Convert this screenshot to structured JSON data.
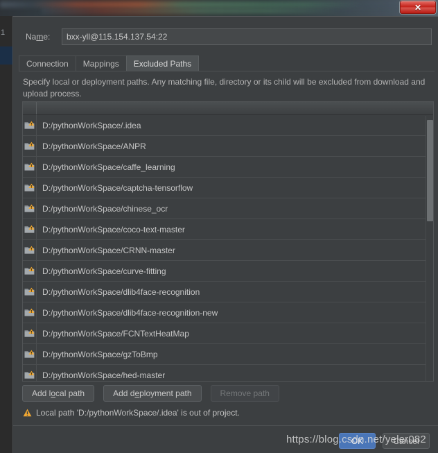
{
  "window": {
    "close_button_glyph": "✕",
    "close_icon_name": "close-icon"
  },
  "dialog": {
    "name_label_pre": "Na",
    "name_label_mnemonic": "m",
    "name_label_post": "e:",
    "name_label": "Name:",
    "name_value": "bxx-yll@115.154.137.54:22",
    "name_placeholder": "",
    "tabs": [
      {
        "label": "Connection",
        "active": false
      },
      {
        "label": "Mappings",
        "active": false
      },
      {
        "label": "Excluded Paths",
        "active": true
      }
    ],
    "description": "Specify local or deployment paths. Any matching file, directory or its child will be excluded from download and upload process."
  },
  "table": {
    "columns": [
      "",
      ""
    ],
    "rows": [
      {
        "path": "D:/pythonWorkSpace/.idea"
      },
      {
        "path": "D:/pythonWorkSpace/ANPR"
      },
      {
        "path": "D:/pythonWorkSpace/caffe_learning"
      },
      {
        "path": "D:/pythonWorkSpace/captcha-tensorflow"
      },
      {
        "path": "D:/pythonWorkSpace/chinese_ocr"
      },
      {
        "path": "D:/pythonWorkSpace/coco-text-master"
      },
      {
        "path": "D:/pythonWorkSpace/CRNN-master"
      },
      {
        "path": "D:/pythonWorkSpace/curve-fitting"
      },
      {
        "path": "D:/pythonWorkSpace/dlib4face-recognition"
      },
      {
        "path": "D:/pythonWorkSpace/dlib4face-recognition-new"
      },
      {
        "path": "D:/pythonWorkSpace/FCNTextHeatMap"
      },
      {
        "path": "D:/pythonWorkSpace/gzToBmp"
      },
      {
        "path": "D:/pythonWorkSpace/hed-master"
      }
    ],
    "row_icon_name": "folder-warning-icon"
  },
  "actions": {
    "add_local_pre": "Add l",
    "add_local_mnemonic": "o",
    "add_local_post": "cal path",
    "add_local_label": "Add local path",
    "add_deployment_pre": "Add d",
    "add_deployment_mnemonic": "e",
    "add_deployment_post": "ployment path",
    "add_deployment_label": "Add deployment path",
    "remove_label": "Remove path",
    "remove_enabled": false
  },
  "status": {
    "warning_text": "Local path 'D:/pythonWorkSpace/.idea' is out of project.",
    "warning_icon_name": "warning-triangle-icon"
  },
  "footer": {
    "ok_label": "OK",
    "cancel_label": "Cancel"
  },
  "watermark": {
    "text": "https://blog.csdn.net/yeler082"
  },
  "background": {
    "gutter_line_number": "1"
  },
  "colors": {
    "dialog_bg": "#3c3f41",
    "text": "#c6c6c6",
    "accent_blue": "#4a76b8",
    "warning_orange": "#f0a732",
    "close_red": "#c4231b",
    "active_tab_bg": "#4e5254"
  }
}
